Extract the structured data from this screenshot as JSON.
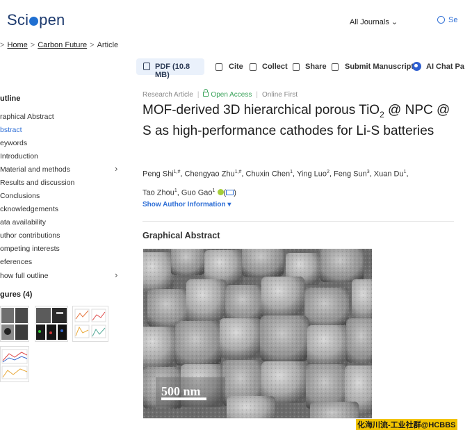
{
  "header": {
    "logo_pre": "Sci",
    "logo_post": "pen",
    "journals_label": "All Journals",
    "search_label": "Se"
  },
  "breadcrumb": {
    "home": "Home",
    "journal": "Carbon Future",
    "current": "Article"
  },
  "toolbar": {
    "pdf": "PDF (10.8 MB)",
    "cite": "Cite",
    "collect": "Collect",
    "share": "Share",
    "submit": "Submit Manuscript",
    "ai_chat": "AI Chat Pa"
  },
  "sidebar": {
    "outline_title": "utline",
    "items": [
      {
        "label": "raphical Abstract"
      },
      {
        "label": "bstract"
      },
      {
        "label": "eywords"
      },
      {
        "label": "Introduction"
      },
      {
        "label": "Material and methods"
      },
      {
        "label": "Results and discussion"
      },
      {
        "label": "Conclusions"
      },
      {
        "label": "cknowledgements"
      },
      {
        "label": "ata availability"
      },
      {
        "label": "uthor contributions"
      },
      {
        "label": "ompeting interests"
      },
      {
        "label": "eferences"
      },
      {
        "label": "how full outline"
      }
    ],
    "figures_title": "gures (4)"
  },
  "article": {
    "type": "Research Article",
    "access": "Open Access",
    "status": "Online First",
    "title_part1": "MOF-derived 3D hierarchical porous TiO",
    "title_sub": "2",
    "title_part2": " @ NPC @ S as high-performance cathodes for Li-S batteries",
    "authors": [
      {
        "name": "Peng Shi",
        "aff": "1,#"
      },
      {
        "name": "Chengyao Zhu",
        "aff": "1,#"
      },
      {
        "name": "Chuxin Chen",
        "aff": "1"
      },
      {
        "name": "Ying Luo",
        "aff": "2"
      },
      {
        "name": "Feng Sun",
        "aff": "3"
      },
      {
        "name": "Xuan Du",
        "aff": "1"
      },
      {
        "name": "Tao Zhou",
        "aff": "1"
      },
      {
        "name": "Guo Gao",
        "aff": "1"
      }
    ],
    "show_author_info": "Show Author Information",
    "graphical_abstract_title": "Graphical Abstract",
    "scale_label": "500 nm"
  },
  "watermark": "化海川流-工业社群@HCBBS",
  "colors": {
    "accent": "#2f6fd6",
    "open_access": "#3aa35a",
    "pdf_bg": "#eaf1fb"
  }
}
